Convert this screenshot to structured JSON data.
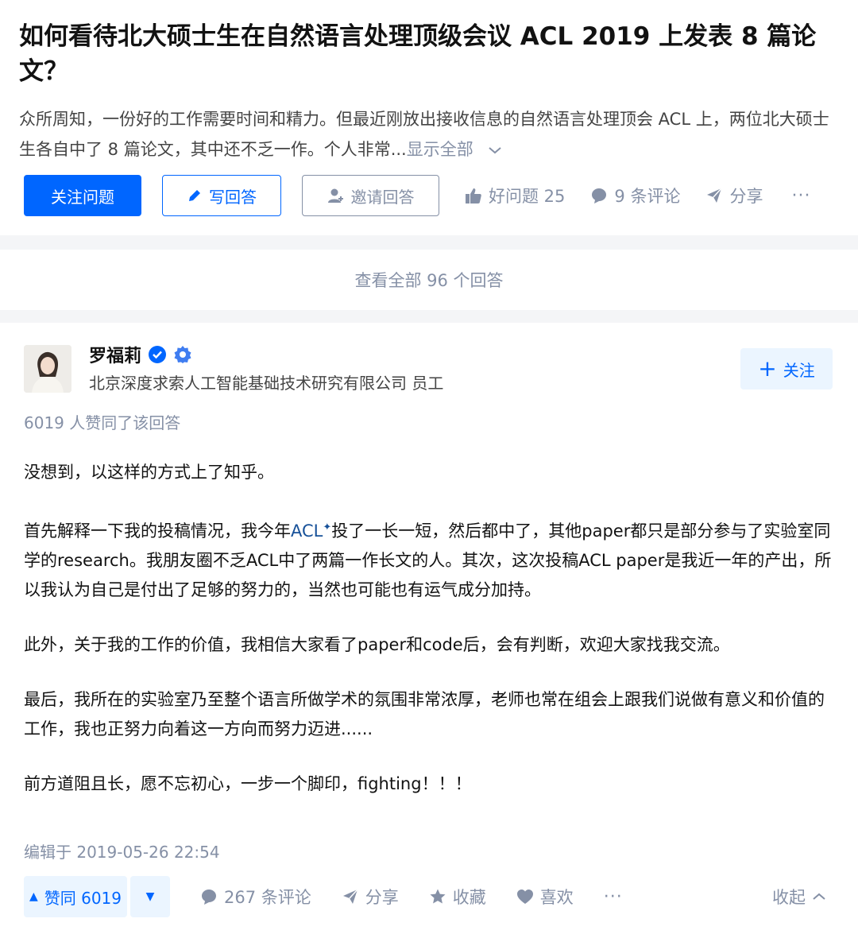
{
  "question": {
    "title": "如何看待北大硕士生在自然语言处理顶级会议 ACL 2019 上发表 8 篇论文？",
    "detail": "众所周知，一份好的工作需要时间和精力。但最近刚放出接收信息的自然语言处理顶会 ACL 上，两位北大硕士生各自中了 8 篇论文，其中还不乏一作。个人非常...",
    "show_all": "显示全部",
    "follow_label": "关注问题",
    "write_label": "写回答",
    "invite_label": "邀请回答",
    "good_question": "好问题 25",
    "comments": "9 条评论",
    "share": "分享",
    "more": "···"
  },
  "view_all": "查看全部 96 个回答",
  "answer": {
    "author_name": "罗福莉",
    "author_desc": "北京深度求索人工智能基础技术研究有限公司 员工",
    "follow_label": "关注",
    "voters": "6019 人赞同了该回答",
    "p1": "没想到，以这样的方式上了知乎。",
    "p2_a": "首先解释一下我的投稿情况，我今年",
    "p2_link": "ACL",
    "p2_b": "投了一长一短，然后都中了，其他paper都只是部分参与了实验室同学的research。我朋友圈不乏ACL中了两篇一作长文的人。其次，这次投稿ACL paper是我近一年的产出，所以我认为自己是付出了足够的努力的，当然也可能也有运气成分加持。",
    "p3": "此外，关于我的工作的价值，我相信大家看了paper和code后，会有判断，欢迎大家找我交流。",
    "p4": "最后，我所在的实验室乃至整个语言所做学术的氛围非常浓厚，老师也常在组会上跟我们说做有意义和价值的工作，我也正努力向着这一方向而努力迈进......",
    "p5": "前方道阻且长，愿不忘初心，一步一个脚印，fighting！！！",
    "edited": "编辑于 2019-05-26 22:54",
    "upvote": "赞同 6019",
    "comments": "267 条评论",
    "share": "分享",
    "favorite": "收藏",
    "like": "喜欢",
    "more": "···",
    "collapse": "收起"
  },
  "colors": {
    "accent": "#0066ff",
    "muted": "#8590a6",
    "link": "#175199"
  }
}
